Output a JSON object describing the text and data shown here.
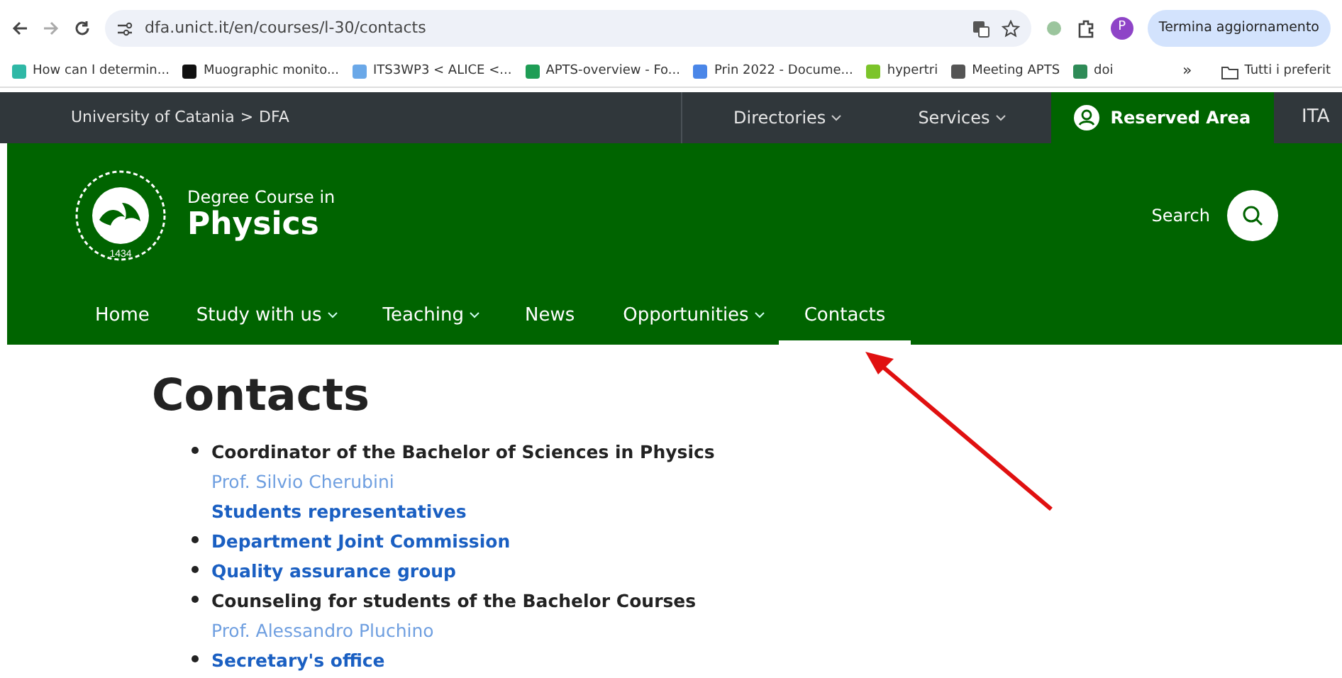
{
  "browser": {
    "url": "dfa.unict.it/en/courses/l-30/contacts",
    "profile_initial": "P",
    "update_button": "Termina aggiornamento"
  },
  "bookmarks": [
    {
      "label": "How can I determin...",
      "color": "#2fb8a6"
    },
    {
      "label": "Muographic monito...",
      "color": "#111111"
    },
    {
      "label": "ITS3WP3 < ALICE <...",
      "color": "#6aa8e8"
    },
    {
      "label": "APTS-overview - Fo...",
      "color": "#1e9d55"
    },
    {
      "label": "Prin 2022 - Docume...",
      "color": "#4a86e8"
    },
    {
      "label": "hypertri",
      "color": "#7cc42a"
    },
    {
      "label": "Meeting APTS",
      "color": "#555555"
    },
    {
      "label": "doi",
      "color": "#2e8b57"
    }
  ],
  "bookmarks_more": "»",
  "bookmarks_folder": "Tutti i preferit",
  "topbar": {
    "breadcrumb": [
      {
        "label": "University of Catania"
      },
      {
        "label": ">"
      },
      {
        "label": "DFA"
      }
    ],
    "menus": [
      {
        "label": "Directories"
      },
      {
        "label": "Services"
      }
    ],
    "reserved_area": "Reserved Area",
    "language": "ITA"
  },
  "header": {
    "subtitle": "Degree Course in",
    "title": "Physics",
    "search_label": "Search",
    "logo_year": "1434"
  },
  "nav": [
    {
      "label": "Home",
      "dropdown": false,
      "selected": false
    },
    {
      "label": "Study with us",
      "dropdown": true,
      "selected": false
    },
    {
      "label": "Teaching",
      "dropdown": true,
      "selected": false
    },
    {
      "label": "News",
      "dropdown": false,
      "selected": false
    },
    {
      "label": "Opportunities",
      "dropdown": true,
      "selected": false
    },
    {
      "label": "Contacts",
      "dropdown": false,
      "selected": true
    }
  ],
  "page_title": "Contacts",
  "contacts": [
    {
      "text": "Coordinator of the Bachelor of Sciences in Physics",
      "kind": "heading",
      "bullet": true
    },
    {
      "text": "Prof. Silvio Cherubini",
      "kind": "person",
      "bullet": false
    },
    {
      "text": "Students representatives",
      "kind": "link",
      "bullet": false
    },
    {
      "text": "Department Joint Commission",
      "kind": "link",
      "bullet": true
    },
    {
      "text": "Quality assurance group",
      "kind": "link",
      "bullet": true
    },
    {
      "text": "Counseling for students of the Bachelor Courses",
      "kind": "heading",
      "bullet": true
    },
    {
      "text": "Prof. Alessandro Pluchino",
      "kind": "person",
      "bullet": false
    },
    {
      "text": "Secretary's office",
      "kind": "link",
      "bullet": true
    }
  ]
}
